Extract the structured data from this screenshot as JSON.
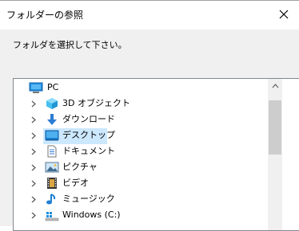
{
  "window": {
    "title": "フォルダーの参照"
  },
  "dialog": {
    "instruction": "フォルダを選択して下さい。"
  },
  "tree": {
    "items": [
      {
        "label": "PC",
        "icon": "pc-icon",
        "expanded": true,
        "level": 0
      },
      {
        "label": "3D オブジェクト",
        "icon": "3d-objects-icon",
        "level": 1
      },
      {
        "label": "ダウンロード",
        "icon": "download-icon",
        "level": 1
      },
      {
        "label": "デスクトップ",
        "icon": "desktop-icon",
        "level": 1,
        "selected": true
      },
      {
        "label": "ドキュメント",
        "icon": "documents-icon",
        "level": 1
      },
      {
        "label": "ピクチャ",
        "icon": "pictures-icon",
        "level": 1
      },
      {
        "label": "ビデオ",
        "icon": "videos-icon",
        "level": 1
      },
      {
        "label": "ミュージック",
        "icon": "music-icon",
        "level": 1
      },
      {
        "label": "Windows (C:)",
        "icon": "drive-icon",
        "level": 1
      }
    ]
  },
  "colors": {
    "selection": "#cce8ff",
    "folder_blue": "#2b7cd3",
    "window_bg": "#f0f0f0"
  }
}
